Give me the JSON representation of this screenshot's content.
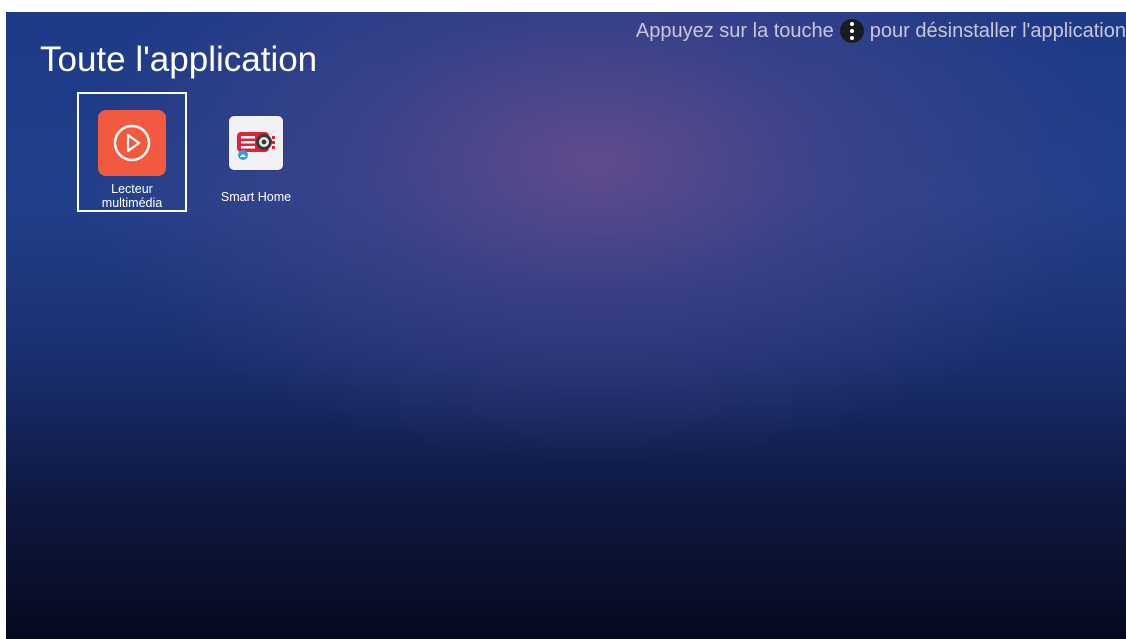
{
  "header": {
    "title": "Toute l'application",
    "hint_before": "Appuyez sur la touche",
    "hint_after": "pour désinstaller l'application",
    "hint_icon": "menu-key-icon"
  },
  "apps": [
    {
      "label_line1": "Lecteur",
      "label_line2": "multimédia",
      "icon": "play-circle-icon",
      "color": "#f25a3f",
      "selected": true
    },
    {
      "label": "Smart Home",
      "icon": "projector-icon",
      "color": "#e0213a",
      "selected": false
    }
  ],
  "colors": {
    "background_top": "#1d3a86",
    "background_bottom": "#06091f",
    "glow": "#644b8c",
    "hint_text": "#c9c6da"
  }
}
